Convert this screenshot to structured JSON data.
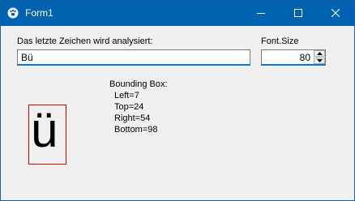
{
  "window": {
    "title": "Form1",
    "icon": "paw-icon",
    "accent_color": "#0063b1"
  },
  "controls": {
    "min_icon": "minimize-icon",
    "max_icon": "maximize-icon",
    "close_icon": "close-icon"
  },
  "input_section": {
    "label": "Das letzte Zeichen wird analysiert:",
    "value": "Bü"
  },
  "font_size": {
    "label": "Font.Size",
    "value": "80"
  },
  "preview": {
    "glyph": "ü",
    "box_color": "#e00000"
  },
  "bounding_box": {
    "title": "Bounding Box:",
    "left": "Left=7",
    "top": "Top=24",
    "right": "Right=54",
    "bottom": "Bottom=98"
  }
}
